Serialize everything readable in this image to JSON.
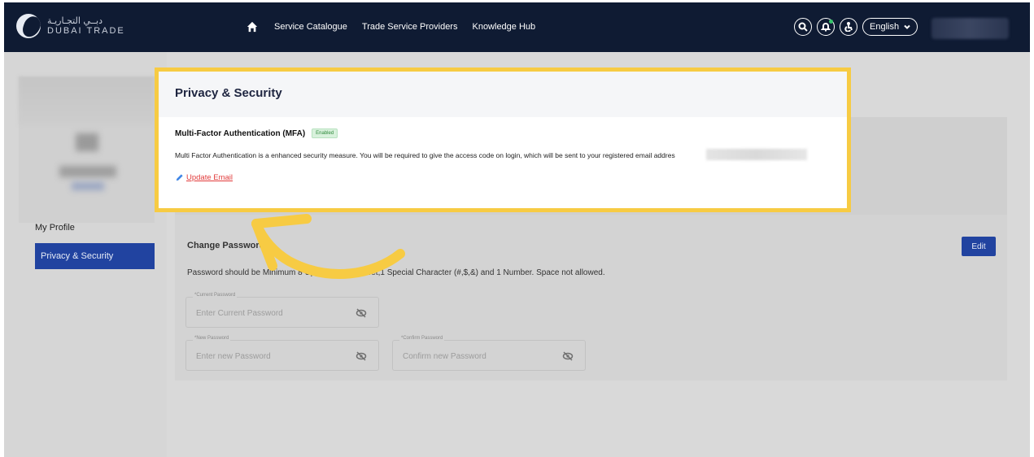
{
  "header": {
    "logo_ar": "دبــي التجـاريـة",
    "logo_en": "DUBAI TRADE",
    "nav": [
      "Service Catalogue",
      "Trade Service Providers",
      "Knowledge Hub"
    ],
    "language": "English",
    "icons": [
      "home-icon",
      "search-icon",
      "bell-icon",
      "accessibility-icon",
      "chevron-down-icon"
    ]
  },
  "sidebar": {
    "items": [
      {
        "label": "My Profile",
        "active": false
      },
      {
        "label": "Privacy & Security",
        "active": true
      }
    ]
  },
  "popup": {
    "title": "Privacy & Security",
    "mfa_title": "Multi-Factor Authentication (MFA)",
    "mfa_badge": "Enabled",
    "mfa_description": "Multi Factor Authentication is a enhanced security measure. You will be required to give the access code on login, which will be sent to your registered email addres",
    "update_link": "Update Email"
  },
  "change_password": {
    "title": "Change Password",
    "description": "Password should be Minimum 8 Uppercase Alphabet,1 Special Character (#,$,&) and 1 Number. Space not allowed.",
    "edit_label": "Edit",
    "fields": [
      {
        "label": "*Current Password",
        "placeholder": "Enter Current Password"
      },
      {
        "label": "*New Password",
        "placeholder": "Enter new Password"
      },
      {
        "label": "*Confirm Password",
        "placeholder": "Confirm new Password"
      }
    ]
  },
  "colors": {
    "nav_bg": "#0f1b33",
    "highlight": "#f7cb43",
    "primary": "#2143a0",
    "link_red": "#e23b3b",
    "badge_green": "#2f8a3c"
  }
}
